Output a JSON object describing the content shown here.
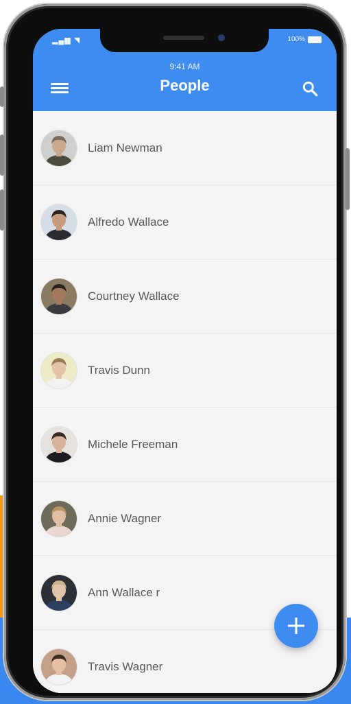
{
  "status_bar": {
    "time": "9:41 AM",
    "battery": "100%"
  },
  "appbar": {
    "title": "People"
  },
  "icons": {
    "menu": "menu-icon",
    "search": "search-icon",
    "add": "plus-icon"
  },
  "people": [
    {
      "name": "Liam Newman",
      "bg": "#cfcfcf",
      "skin": "#c9a98a",
      "hair": "#7b6a5b",
      "shirt": "#4b4a3d"
    },
    {
      "name": "Alfredo Wallace",
      "bg": "#d7dde6",
      "skin": "#c89b7d",
      "hair": "#2b2522",
      "shirt": "#2c2c34"
    },
    {
      "name": "Courtney Wallace",
      "bg": "#8b7a62",
      "skin": "#a47a5c",
      "hair": "#2b231d",
      "shirt": "#3a3b3f"
    },
    {
      "name": "Travis Dunn",
      "bg": "#ecebc6",
      "skin": "#e3c4a6",
      "hair": "#9c7b58",
      "shirt": "#f2f2f2"
    },
    {
      "name": "Michele Freeman",
      "bg": "#e6e2de",
      "skin": "#d9b29a",
      "hair": "#3a2c24",
      "shirt": "#1e1e22"
    },
    {
      "name": "Annie Wagner",
      "bg": "#6d6a58",
      "skin": "#e0bfa4",
      "hair": "#b9935f",
      "shirt": "#e9d7cd"
    },
    {
      "name": "Ann Wallace r",
      "bg": "#2c2f36",
      "skin": "#e2c3a9",
      "hair": "#c7b48a",
      "shirt": "#2f3f62"
    },
    {
      "name": "Travis Wagner",
      "bg": "#c4a089",
      "skin": "#e4bfa2",
      "hair": "#3a2a20",
      "shirt": "#f3f3f3"
    }
  ]
}
